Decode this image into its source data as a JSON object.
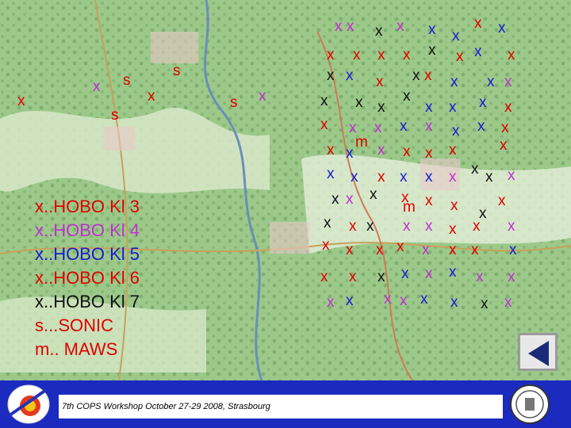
{
  "legend": [
    {
      "text": "x..HOBO Kl 3",
      "color": "#e10000"
    },
    {
      "text": "x..HOBO Kl 4",
      "color": "#c02fd0"
    },
    {
      "text": "x..HOBO Kl 5",
      "color": "#1a1ad0"
    },
    {
      "text": "x..HOBO Kl 6",
      "color": "#e10000"
    },
    {
      "text": "x..HOBO Kl 7",
      "color": "#111111"
    },
    {
      "text": "s...SONIC",
      "color": "#e10000"
    },
    {
      "text": "m.. MAWS",
      "color": "#e10000"
    }
  ],
  "footer": {
    "text": "7th COPS Workshop  October 27-29 2008, Strasbourg"
  },
  "colors": {
    "red": "#e10000",
    "purple": "#c02fd0",
    "blue": "#1a1ad0",
    "black": "#111111",
    "footer_bar": "#1b2abf"
  },
  "map_markers_sample": [
    "x",
    "s",
    "m"
  ]
}
